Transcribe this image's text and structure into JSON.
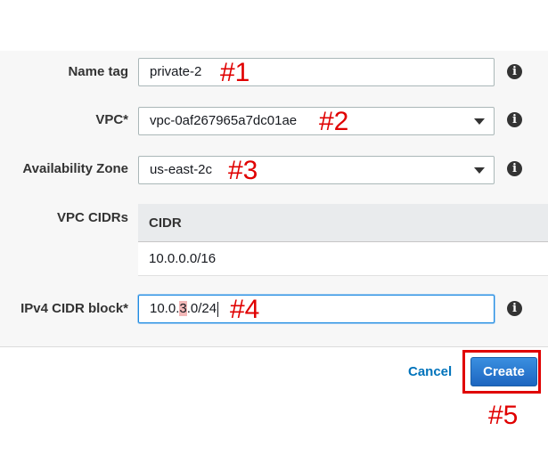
{
  "form": {
    "name_tag": {
      "label": "Name tag",
      "value": "private-2"
    },
    "vpc": {
      "label": "VPC*",
      "value": "vpc-0af267965a7dc01ae"
    },
    "availability_zone": {
      "label": "Availability Zone",
      "value": "us-east-2c"
    },
    "vpc_cidrs": {
      "label": "VPC CIDRs",
      "column_header": "CIDR",
      "rows": [
        "10.0.0.0/16"
      ]
    },
    "ipv4_cidr_block": {
      "label": "IPv4 CIDR block*",
      "value_prefix": "10.0.",
      "value_highlight": "3",
      "value_suffix": ".0/24"
    }
  },
  "actions": {
    "cancel_label": "Cancel",
    "create_label": "Create"
  },
  "annotations": {
    "a1": "#1",
    "a2": "#2",
    "a3": "#3",
    "a4": "#4",
    "a5": "#5"
  },
  "icons": {
    "info": "info-icon",
    "dropdown": "chevron-down-icon"
  },
  "colors": {
    "annotation": "#e00000",
    "primary_button": "#1d66c0",
    "link": "#0073bb",
    "highlight": "#f4b8b8"
  }
}
